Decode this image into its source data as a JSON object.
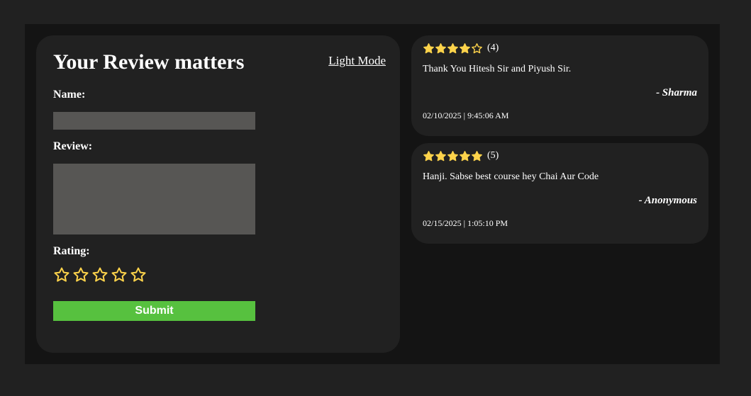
{
  "form": {
    "title": "Your Review matters",
    "theme_toggle": "Light Mode",
    "name_label": "Name:",
    "name_value": "",
    "review_label": "Review:",
    "review_value": "",
    "rating_label": "Rating:",
    "rating_value": 0,
    "rating_max": 5,
    "submit_label": "Submit"
  },
  "reviews": [
    {
      "stars": 4,
      "rating_text": "(4)",
      "text": "Thank You Hitesh Sir and Piyush Sir.",
      "author": "- Sharma",
      "date": "02/10/2025 | 9:45:06 AM"
    },
    {
      "stars": 5,
      "rating_text": "(5)",
      "text": "Hanji. Sabse best course hey Chai Aur Code",
      "author": "- Anonymous",
      "date": "02/15/2025 | 1:05:10 PM"
    }
  ],
  "colors": {
    "background": "#212121",
    "panel": "#141414",
    "card": "#212121",
    "input": "#575654",
    "star": "#fdd34b",
    "submit": "#57c13f",
    "text": "#ffffff"
  },
  "icons": {
    "rating_star_empty": "star-outline-icon",
    "rating_star_filled": "star-filled-icon"
  }
}
